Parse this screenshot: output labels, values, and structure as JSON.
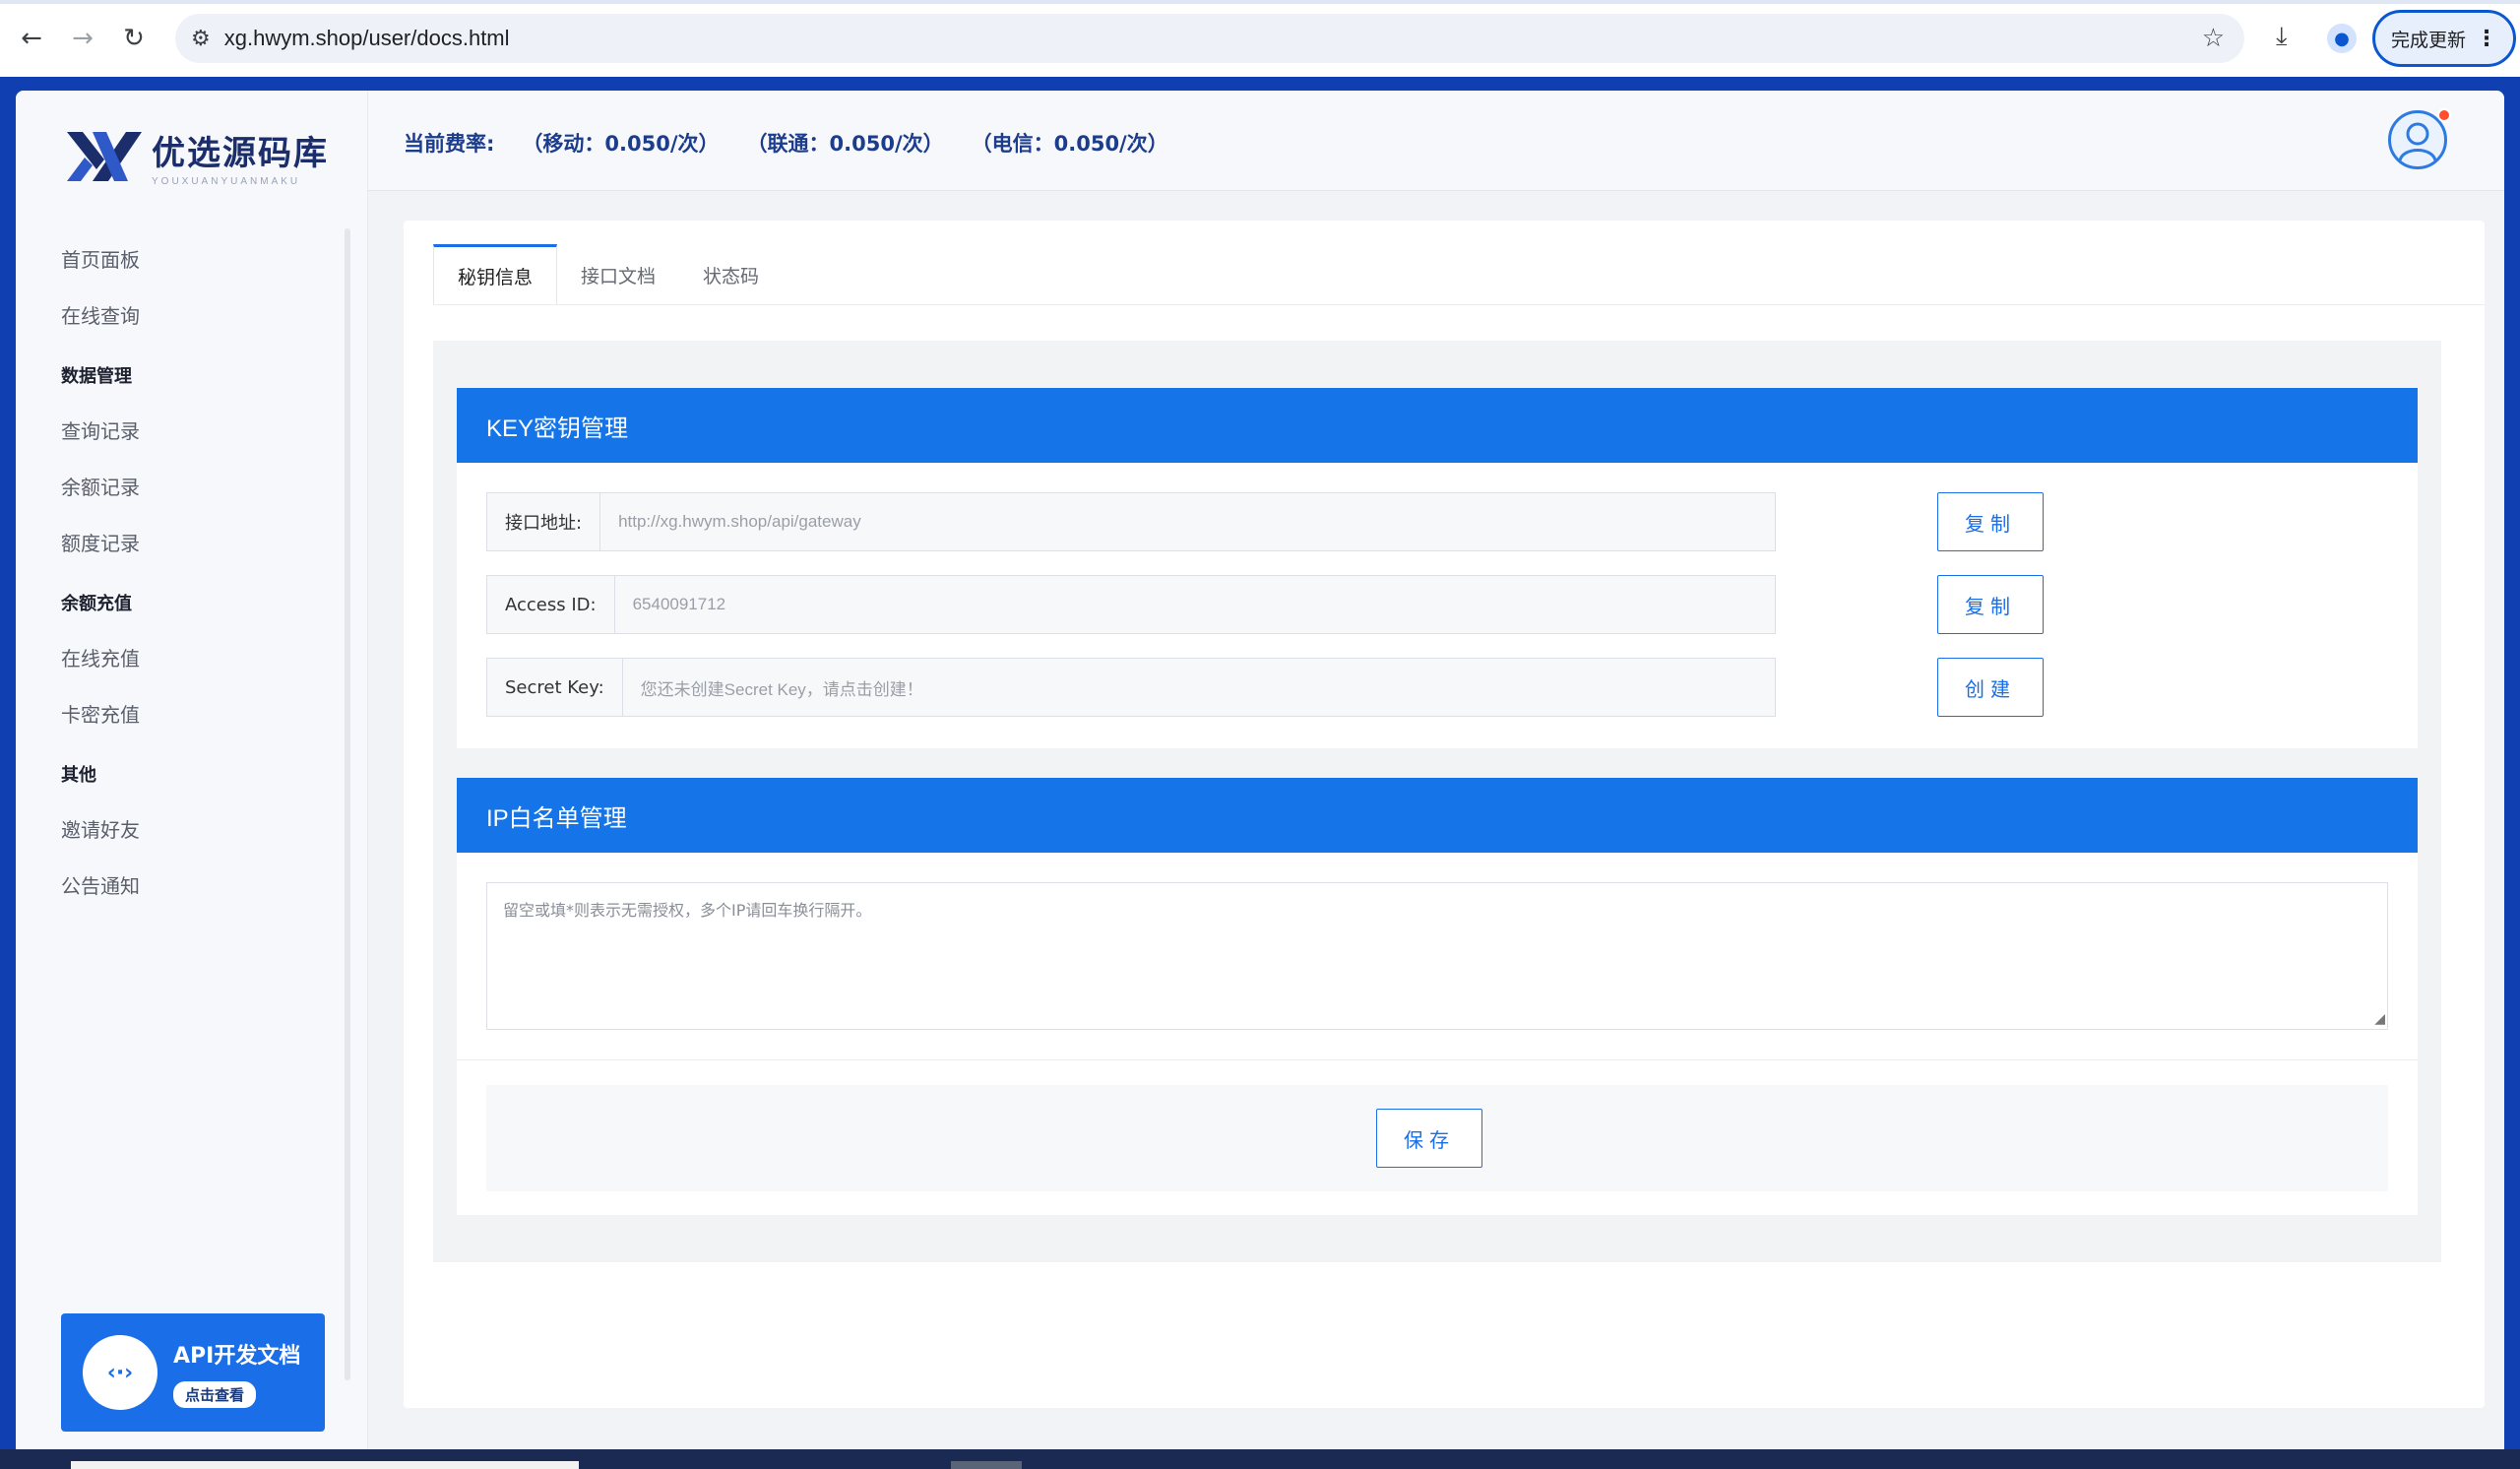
{
  "browser": {
    "url": "xg.hwym.shop/user/docs.html",
    "update_label": "完成更新"
  },
  "logo": {
    "title": "优选源码库",
    "subtitle": "YOUXUANYUANMAKU"
  },
  "header": {
    "rate_label": "当前费率:",
    "rates": [
      "（移动：0.050/次）",
      "（联通：0.050/次）",
      "（电信：0.050/次）"
    ]
  },
  "sidebar": {
    "items": [
      {
        "type": "item",
        "label": "首页面板"
      },
      {
        "type": "item",
        "label": "在线查询"
      },
      {
        "type": "group",
        "label": "数据管理"
      },
      {
        "type": "item",
        "label": "查询记录"
      },
      {
        "type": "item",
        "label": "余额记录"
      },
      {
        "type": "item",
        "label": "额度记录"
      },
      {
        "type": "group",
        "label": "余额充值"
      },
      {
        "type": "item",
        "label": "在线充值"
      },
      {
        "type": "item",
        "label": "卡密充值"
      },
      {
        "type": "group",
        "label": "其他"
      },
      {
        "type": "item",
        "label": "邀请好友"
      },
      {
        "type": "item",
        "label": "公告通知"
      }
    ],
    "api_card": {
      "title": "API开发文档",
      "button": "点击查看"
    }
  },
  "tabs": [
    "秘钥信息",
    "接口文档",
    "状态码"
  ],
  "key_panel": {
    "title": "KEY密钥管理",
    "fields": [
      {
        "label": "接口地址:",
        "value": "http://xg.hwym.shop/api/gateway",
        "button": "复制"
      },
      {
        "label": "Access ID:",
        "value": "6540091712",
        "button": "复制"
      },
      {
        "label": "Secret Key:",
        "value": "您还未创建Secret Key，请点击创建！",
        "button": "创建"
      }
    ]
  },
  "ip_panel": {
    "title": "IP白名单管理",
    "placeholder": "留空或填*则表示无需授权，多个IP请回车换行隔开。",
    "save_label": "保存"
  },
  "colors": {
    "brand_blue": "#1574e8",
    "page_bg": "#0f3fb0",
    "rate_text": "#1c3c8c"
  }
}
